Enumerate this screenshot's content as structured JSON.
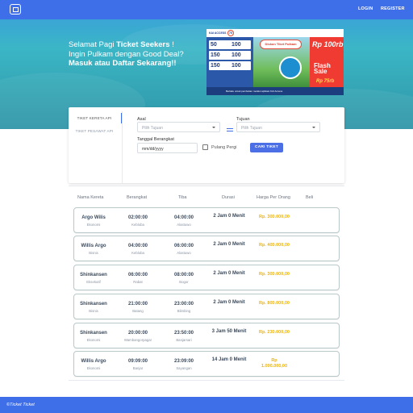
{
  "nav": {
    "login": "LOGIN",
    "register": "REGISTER"
  },
  "hero": {
    "greeting_prefix": "Selamat Pagi ",
    "greeting_name": "Ticket Seekers",
    "greeting_suffix": " !",
    "line2": "Ingin Pulkam dengan Good Deal?",
    "line3": "Masuk atau Daftar Sekarang!!"
  },
  "banner": {
    "brand1": "KAI ACCESS",
    "brand2": "75",
    "prices": [
      [
        "50",
        "100"
      ],
      [
        "150",
        "100"
      ],
      [
        "150",
        "100"
      ]
    ],
    "title": "Diskon Tiket Pulkam",
    "rp": "Rp 100rb",
    "flash_1": "Flash",
    "flash_2": "Sale",
    "rp2": "Rp 75rb",
    "footer": "Berlaku untuk pembelian melalui aplikasi KAI Access"
  },
  "search": {
    "tabs": [
      "TIKET KERETA API",
      "TIKET PESAWAT API"
    ],
    "asal_label": "Asal",
    "asal_placeholder": "Pilih Tujuan",
    "tujuan_label": "Tujuan",
    "tujuan_placeholder": "Pilih Tujuan",
    "tanggal_label": "Tanggal Berangkat",
    "date_value": "mm/dd/yyyy",
    "pulang_pergi": "Pulang Pergi",
    "cari_button": "CARI TIKET"
  },
  "results": {
    "headers": [
      "Nama Kereta",
      "Berangkat",
      "Tiba",
      "Durasi",
      "Harga Per Orang",
      "Beli"
    ],
    "rows": [
      {
        "name": "Argo Wilis",
        "class": "Ekonomi",
        "depart": "02:00:00",
        "from": "Kebloba",
        "arrive": "04:00:00",
        "to": "Alastuwo",
        "duration": "2 Jam 0 Menit",
        "price": "Rp. 300.000,00",
        "price2": ""
      },
      {
        "name": "Willis Argo",
        "class": "Bisnis",
        "depart": "04:00:00",
        "from": "Kebloba",
        "arrive": "06:00:00",
        "to": "Alastuwo",
        "duration": "2 Jam 0 Menit",
        "price": "Rp. 400.000,00",
        "price2": ""
      },
      {
        "name": "Shinkansen",
        "class": "Eksekutif",
        "depart": "06:00:00",
        "from": "Rabat",
        "arrive": "08:00:00",
        "to": "Bogor",
        "duration": "2 Jam 0 Menit",
        "price": "Rp. 300.000,00",
        "price2": ""
      },
      {
        "name": "Shinkansen",
        "class": "Bisnis",
        "depart": "21:00:00",
        "from": "Batang",
        "arrive": "23:00:00",
        "to": "Blimbing",
        "duration": "2 Jam 0 Menit",
        "price": "Rp. 800.000,00",
        "price2": ""
      },
      {
        "name": "Shinkansen",
        "class": "Ekonomi",
        "depart": "20:00:00",
        "from": "Wambangorpagar",
        "arrive": "23:50:00",
        "to": "Banjarsari",
        "duration": "3 Jam 50 Menit",
        "price": "Rp. 230.000,00",
        "price2": ""
      },
      {
        "name": "Willis Argo",
        "class": "Ekonomi",
        "depart": "09:09:00",
        "from": "Banjar",
        "arrive": "23:09:00",
        "to": "Sayangan",
        "duration": "14 Jam 0 Menit",
        "price": "Rp",
        "price2": "1.000.000,00"
      }
    ]
  },
  "footer": {
    "text": "©Ticket Ticket"
  }
}
